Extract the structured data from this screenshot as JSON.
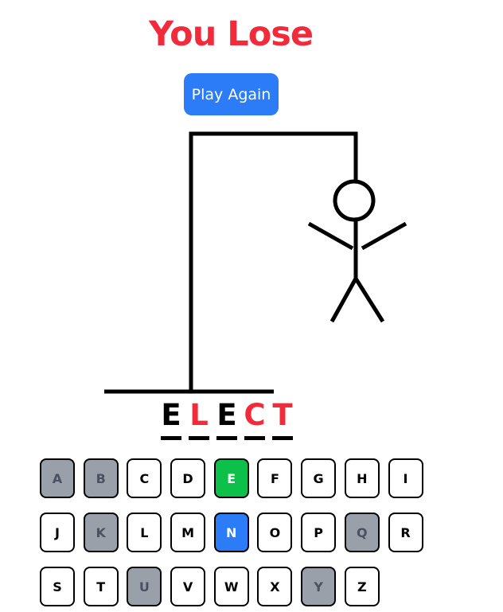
{
  "status": {
    "message": "You Lose"
  },
  "controls": {
    "play_again_label": "Play Again"
  },
  "word": [
    {
      "char": "E",
      "state": "revealed"
    },
    {
      "char": "L",
      "state": "missed"
    },
    {
      "char": "E",
      "state": "revealed"
    },
    {
      "char": "C",
      "state": "missed"
    },
    {
      "char": "T",
      "state": "missed"
    }
  ],
  "keyboard": [
    {
      "key": "A",
      "state": "wrong"
    },
    {
      "key": "B",
      "state": "wrong"
    },
    {
      "key": "C",
      "state": "unused"
    },
    {
      "key": "D",
      "state": "unused"
    },
    {
      "key": "E",
      "state": "correct"
    },
    {
      "key": "F",
      "state": "unused"
    },
    {
      "key": "G",
      "state": "unused"
    },
    {
      "key": "H",
      "state": "unused"
    },
    {
      "key": "I",
      "state": "unused"
    },
    {
      "key": "J",
      "state": "unused"
    },
    {
      "key": "K",
      "state": "wrong"
    },
    {
      "key": "L",
      "state": "unused"
    },
    {
      "key": "M",
      "state": "unused"
    },
    {
      "key": "N",
      "state": "active"
    },
    {
      "key": "O",
      "state": "unused"
    },
    {
      "key": "P",
      "state": "unused"
    },
    {
      "key": "Q",
      "state": "wrong"
    },
    {
      "key": "R",
      "state": "unused"
    },
    {
      "key": "S",
      "state": "unused"
    },
    {
      "key": "T",
      "state": "unused"
    },
    {
      "key": "U",
      "state": "wrong"
    },
    {
      "key": "V",
      "state": "unused"
    },
    {
      "key": "W",
      "state": "unused"
    },
    {
      "key": "X",
      "state": "unused"
    },
    {
      "key": "Y",
      "state": "wrong"
    },
    {
      "key": "Z",
      "state": "unused"
    }
  ],
  "colors": {
    "lose_text": "#f12b3c",
    "button": "#2b7cf6",
    "wrong_key": "#9aa0aa",
    "correct_key": "#0cc04a",
    "active_key": "#2b7cf6"
  }
}
